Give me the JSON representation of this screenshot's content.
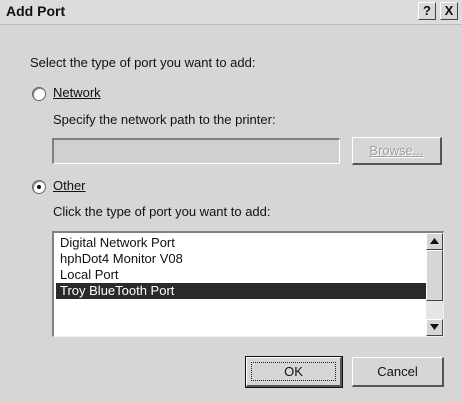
{
  "dialog": {
    "title": "Add Port",
    "help_button": "?",
    "close_button": "X",
    "instruction": "Select the type of port you want to add:"
  },
  "network_option": {
    "label": "Network",
    "selected": false,
    "description": "Specify the network path to the printer:",
    "path_value": "",
    "browse_label": "Browse..."
  },
  "other_option": {
    "label": "Other",
    "selected": true,
    "description": "Click the type of port you want to add:"
  },
  "port_list": {
    "items": [
      "Digital Network Port",
      "hphDot4 Monitor V08",
      "Local Port",
      "Troy BlueTooth Port"
    ],
    "selected_index": 3
  },
  "footer": {
    "ok_label": "OK",
    "cancel_label": "Cancel"
  },
  "colors": {
    "selection": "#2a2a2a",
    "face": "#d6d6d6"
  }
}
